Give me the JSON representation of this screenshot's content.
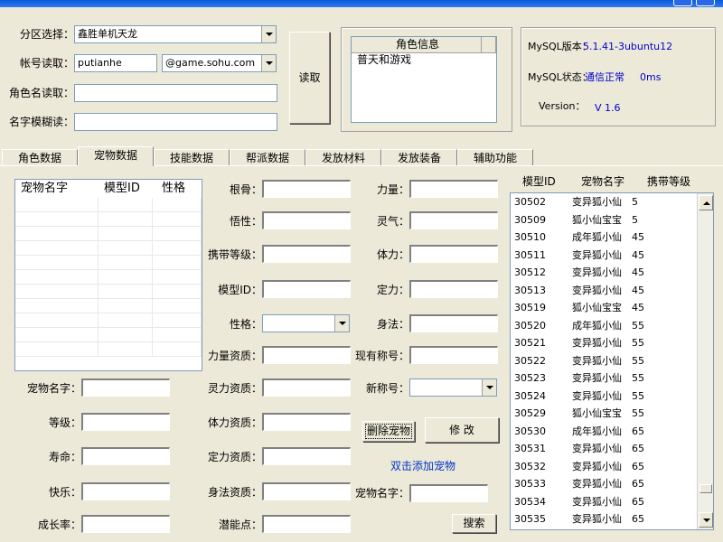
{
  "top": {
    "zone_label": "分区选择：",
    "zone_value": "鑫胜单机天龙",
    "account_label": "帐号读取：",
    "account_value": "putianhe",
    "domain_value": "@game.sohu.com",
    "role_label": "角色名读取：",
    "fuzzy_label": "名字模糊读：",
    "read_button": "读取",
    "role_info_header": "角色信息",
    "role_info_items": [
      "普天和游戏"
    ],
    "mysql_version_label": "MySQL版本：",
    "mysql_version_value": "5.1.41-3ubuntu12",
    "mysql_status_label": "MySQL状态：",
    "mysql_status_value": "通信正常",
    "mysql_latency": "0ms",
    "version_label": "Version：",
    "version_value": "V 1.6"
  },
  "tabs": [
    "角色数据",
    "宠物数据",
    "技能数据",
    "帮派数据",
    "发放材料",
    "发放装备",
    "辅助功能"
  ],
  "pet_grid": {
    "headers": [
      "宠物名字",
      "模型ID",
      "性格"
    ]
  },
  "left_form": {
    "pet_name_label": "宠物名字：",
    "level_label": "等级：",
    "life_label": "寿命：",
    "happy_label": "快乐：",
    "growth_label": "成长率："
  },
  "mid_form": {
    "root_label": "根骨：",
    "wisdom_label": "悟性：",
    "carry_label": "携带等级：",
    "model_label": "模型ID：",
    "nature_label": "性格：",
    "str_apt_label": "力量资质：",
    "spirit_apt_label": "灵力资质：",
    "con_apt_label": "体力资质：",
    "focus_apt_label": "定力资质：",
    "agi_apt_label": "身法资质：",
    "potential_label": "潜能点："
  },
  "right_form": {
    "str_label": "力量：",
    "spirit_label": "灵气：",
    "con_label": "体力：",
    "focus_label": "定力：",
    "agi_label": "身法：",
    "title_label": "现有称号：",
    "new_title_label": "新称号：",
    "delete_button": "删除宠物",
    "modify_button": "修  改",
    "hint": "双击添加宠物",
    "search_name_label": "宠物名字：",
    "search_button": "搜索"
  },
  "pet_catalog": {
    "headers": [
      "模型ID",
      "宠物名字",
      "携带等级"
    ],
    "rows": [
      {
        "id": "30502",
        "name": "变异狐小仙",
        "level": "5"
      },
      {
        "id": "30509",
        "name": "狐小仙宝宝",
        "level": "5"
      },
      {
        "id": "30510",
        "name": "成年狐小仙",
        "level": "45"
      },
      {
        "id": "30511",
        "name": "变异狐小仙",
        "level": "45"
      },
      {
        "id": "30512",
        "name": "变异狐小仙",
        "level": "45"
      },
      {
        "id": "30513",
        "name": "变异狐小仙",
        "level": "45"
      },
      {
        "id": "30519",
        "name": "狐小仙宝宝",
        "level": "45"
      },
      {
        "id": "30520",
        "name": "成年狐小仙",
        "level": "55"
      },
      {
        "id": "30521",
        "name": "变异狐小仙",
        "level": "55"
      },
      {
        "id": "30522",
        "name": "变异狐小仙",
        "level": "55"
      },
      {
        "id": "30523",
        "name": "变异狐小仙",
        "level": "55"
      },
      {
        "id": "30524",
        "name": "变异狐小仙",
        "level": "55"
      },
      {
        "id": "30529",
        "name": "狐小仙宝宝",
        "level": "55"
      },
      {
        "id": "30530",
        "name": "成年狐小仙",
        "level": "65"
      },
      {
        "id": "30531",
        "name": "变异狐小仙",
        "level": "65"
      },
      {
        "id": "30532",
        "name": "变异狐小仙",
        "level": "65"
      },
      {
        "id": "30533",
        "name": "变异狐小仙",
        "level": "65"
      },
      {
        "id": "30534",
        "name": "变异狐小仙",
        "level": "65"
      },
      {
        "id": "30535",
        "name": "变异狐小仙",
        "level": "65"
      }
    ]
  }
}
